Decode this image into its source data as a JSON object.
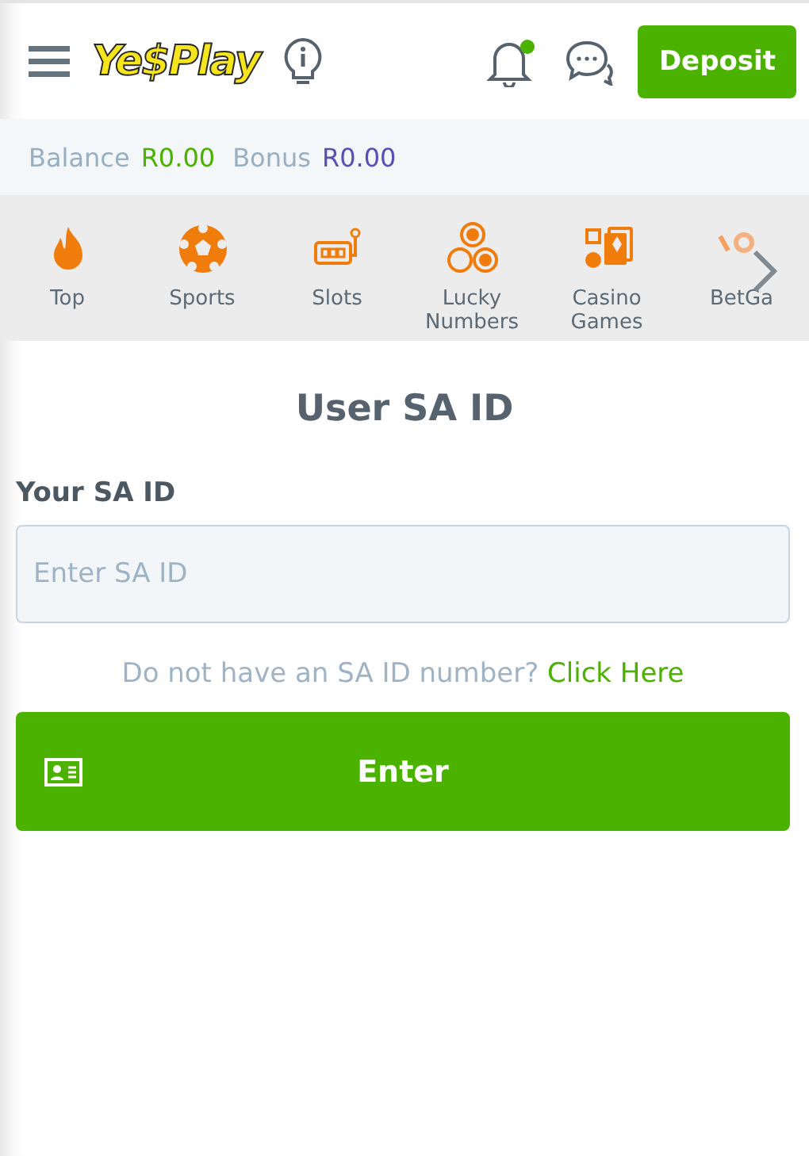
{
  "header": {
    "logo": "Ye$Play",
    "has_notification": true,
    "deposit_button": "Deposit"
  },
  "balance": {
    "balance_label": "Balance",
    "balance_value": "R0.00",
    "bonus_label": "Bonus",
    "bonus_value": "R0.00"
  },
  "categories": [
    {
      "label": "Top",
      "kind": "fire"
    },
    {
      "label": "Sports",
      "kind": "ball"
    },
    {
      "label": "Slots",
      "kind": "slot"
    },
    {
      "label": "Lucky Numbers",
      "kind": "balls"
    },
    {
      "label": "Casino Games",
      "kind": "cards"
    },
    {
      "label": "BetGa",
      "kind": "partial"
    }
  ],
  "form": {
    "title": "User SA ID",
    "field_label": "Your SA ID",
    "placeholder": "Enter SA ID",
    "hint": "Do not have an SA ID number?",
    "link": "Click Here",
    "submit": "Enter"
  }
}
